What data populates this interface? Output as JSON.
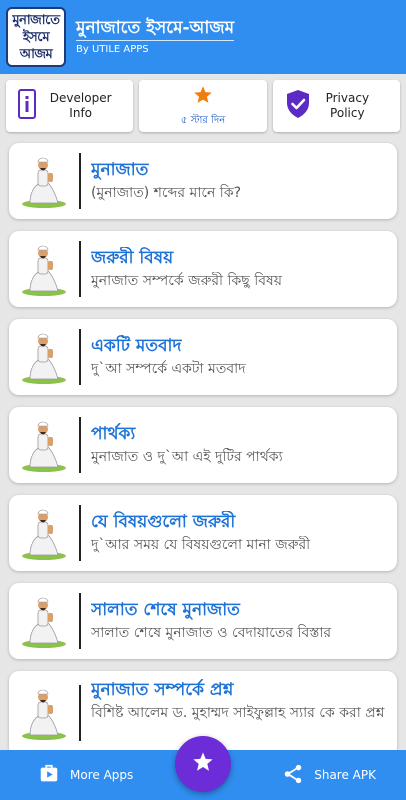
{
  "header": {
    "logo_lines": [
      "মুনাজাতে",
      "ইসমে",
      "আজম"
    ],
    "title": "মুনাজাতে ইসমে-আজম",
    "subtitle": "By UTILE APPS"
  },
  "actions": {
    "developer_label": "Developer\nInfo",
    "rating_label": "৫ স্টার দিন",
    "privacy_label": "Privacy\nPolicy"
  },
  "items": [
    {
      "title": "মুনাজাত",
      "desc": "(মুনাজাত) শব্দের মানে কি?"
    },
    {
      "title": "জরুরী বিষয়",
      "desc": "মুনাজাত সম্পর্কে জরুরী কিছু বিষয়"
    },
    {
      "title": "একটি মতবাদ",
      "desc": "দু`আ সম্পর্কে একটা মতবাদ"
    },
    {
      "title": "পার্থক্য",
      "desc": "মুনাজাত ও দু`আ এই দুটির পার্থক্য"
    },
    {
      "title": "যে বিষয়গুলো জরুরী",
      "desc": "দু`আর সময় যে বিষয়গুলো মানা জরুরী"
    },
    {
      "title": "সালাত শেষে মুনাজাত",
      "desc": "সালাত শেষে মুনাজাত ও বেদায়াতের বিস্তার"
    },
    {
      "title": "মুনাজাত সম্পর্কে প্রশ্ন",
      "desc": "বিশিষ্ট আলেম ড. মুহাম্মদ সাইফুল্লাহ স্যার কে করা প্রশ্ন"
    }
  ],
  "bottom": {
    "more_apps": "More Apps",
    "share_apk": "Share APK"
  },
  "colors": {
    "primary": "#2f8ef0",
    "fab": "#6c2cd8",
    "title_text": "#1e73d8"
  }
}
